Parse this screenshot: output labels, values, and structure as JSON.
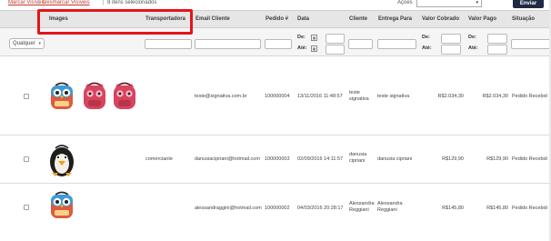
{
  "toolbar": {
    "mark_visible": "Marcar Visíveis",
    "separator": "|",
    "unmark_visible": "Desmarcar Visíveis",
    "items_selected": "8 itens selecionados",
    "actions_label": "Ações",
    "actions_select_arrow": "▾",
    "send_button": "Enviar"
  },
  "columns": {
    "images": "Images",
    "carrier": "Transportadora",
    "email": "Email Cliente",
    "order": "Pedido #",
    "date": "Data",
    "customer": "Cliente",
    "delivery": "Entrega Para",
    "charged": "Valor Cobrado",
    "paid": "Valor Pago",
    "status": "Situação"
  },
  "filters": {
    "any_option": "Qualquer",
    "date_from": "De:",
    "date_to": "Até:",
    "calendar_icon": "calendar-icon"
  },
  "orders": [
    {
      "email": "teste@signativa.com.br",
      "order_id": "100000004",
      "date": "13/11/2016 11:48:57",
      "customer": [
        "teste",
        "signativa"
      ],
      "delivery": "teste signativa",
      "charged": "R$2.034,30",
      "paid": "R$2.034,30",
      "status": "Pedido Recebid",
      "carrier": "",
      "images": [
        "owl-backpack",
        "pink-backpack",
        "pink-backpack"
      ]
    },
    {
      "email": "danusiacipriani@hotmail.com",
      "order_id": "100000003",
      "date": "02/09/2016 14:11:57",
      "customer": [
        "danusia",
        "cipriani"
      ],
      "delivery": "danusia cipriani",
      "charged": "R$129,90",
      "paid": "R$129,90",
      "status": "Pedido Recebid",
      "carrier": "comerciante",
      "images": [
        "penguin-backpack"
      ]
    },
    {
      "email": "alessandraggini@hotmail.com",
      "order_id": "100000002",
      "date": "04/03/2016 20:28:17",
      "customer": [
        "Alessandra",
        "Reggiani"
      ],
      "delivery": [
        "Alessandra",
        "Reggiani"
      ],
      "charged": "R$145,80",
      "paid": "R$145,80",
      "status": "Pedido Recebid",
      "carrier": "",
      "images": [
        "owl-backpack"
      ]
    }
  ],
  "colors": {
    "link": "#c0392b",
    "header_bg": "#e6e6e6",
    "highlight_box": "#e3151a",
    "send_button_bg": "#1f2a44"
  }
}
